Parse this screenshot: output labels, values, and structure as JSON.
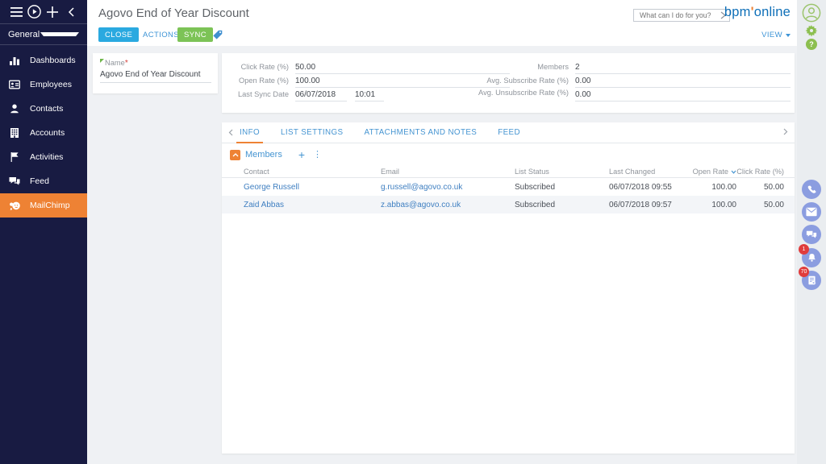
{
  "topbar": {
    "title": "Agovo End of Year Discount",
    "close_label": "CLOSE",
    "actions_label": "ACTIONS",
    "sync_label": "SYNC",
    "search_placeholder": "What can I do for you?",
    "logo_prefix": "bpm",
    "logo_mark": "'",
    "logo_suffix": "online",
    "view_label": "VIEW"
  },
  "sidebar": {
    "workspace": "General",
    "items": [
      {
        "label": "Dashboards"
      },
      {
        "label": "Employees"
      },
      {
        "label": "Contacts"
      },
      {
        "label": "Accounts"
      },
      {
        "label": "Activities"
      },
      {
        "label": "Feed"
      },
      {
        "label": "MailChimp"
      }
    ]
  },
  "form": {
    "name_label": "Name",
    "required_mark": "*",
    "name_value": "Agovo End of Year Discount",
    "click_rate_label": "Click Rate (%)",
    "click_rate_value": "50.00",
    "open_rate_label": "Open Rate (%)",
    "open_rate_value": "100.00",
    "last_sync_label": "Last Sync Date",
    "last_sync_date": "06/07/2018",
    "last_sync_time": "10:01",
    "members_label": "Members",
    "members_value": "2",
    "avg_sub_label": "Avg. Subscribe Rate (%)",
    "avg_sub_value": "0.00",
    "avg_unsub_label": "Avg. Unsubscribe Rate (%)",
    "avg_unsub_value": "0.00"
  },
  "tabs": [
    {
      "label": "INFO"
    },
    {
      "label": "LIST SETTINGS"
    },
    {
      "label": "ATTACHMENTS AND NOTES"
    },
    {
      "label": "FEED"
    }
  ],
  "members": {
    "title": "Members",
    "columns": {
      "contact": "Contact",
      "email": "Email",
      "status": "List Status",
      "changed": "Last Changed",
      "open": "Open Rate",
      "click": "Click Rate (%)"
    },
    "rows": [
      {
        "contact": "George Russell",
        "email": "g.russell@agovo.co.uk",
        "status": "Subscribed",
        "changed": "06/07/2018 09:55",
        "open": "100.00",
        "click": "50.00"
      },
      {
        "contact": "Zaid Abbas",
        "email": "z.abbas@agovo.co.uk",
        "status": "Subscribed",
        "changed": "06/07/2018 09:57",
        "open": "100.00",
        "click": "50.00"
      }
    ]
  },
  "right_panel": {
    "notification_badge": "1",
    "task_badge": "70"
  },
  "icons": {
    "plus": "+",
    "kebab": "⋮",
    "question": "?"
  },
  "colors": {
    "sidebar_navy": "#181b42",
    "accent_orange": "#ee8234",
    "primary_blue": "#2aa9e0",
    "action_green": "#7cc356",
    "link_blue": "#4090d0",
    "icon_green": "#8cbf4f",
    "comm_icon_blue": "#8b9de0",
    "badge_red": "#e03c3c",
    "logo_blue": "#0e6fb8"
  }
}
